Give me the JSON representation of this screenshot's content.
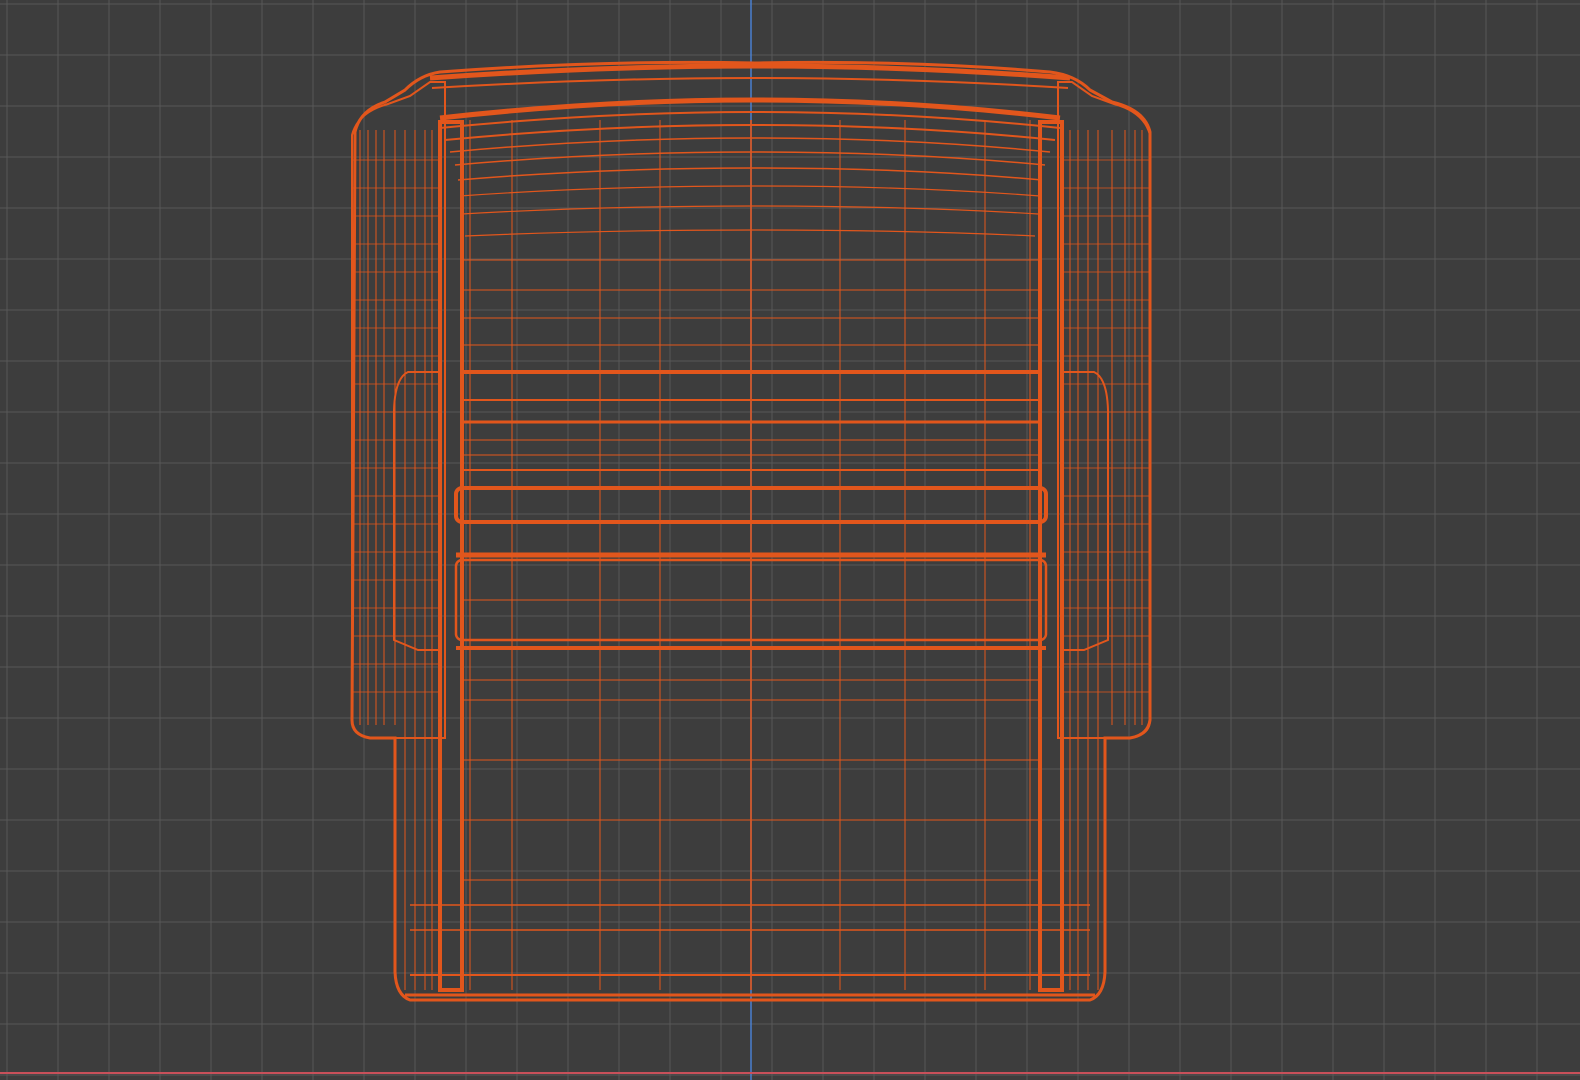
{
  "viewport": {
    "view": "top",
    "grid_visible": true,
    "colors": {
      "background": "#3d3d3d",
      "grid_line": "#585858",
      "axis_y": "#4a7fd0",
      "axis_x": "#c8505a",
      "wireframe": "#e2561c"
    }
  },
  "object": {
    "type": "armchair",
    "display_mode": "wireframe",
    "selected": true
  }
}
